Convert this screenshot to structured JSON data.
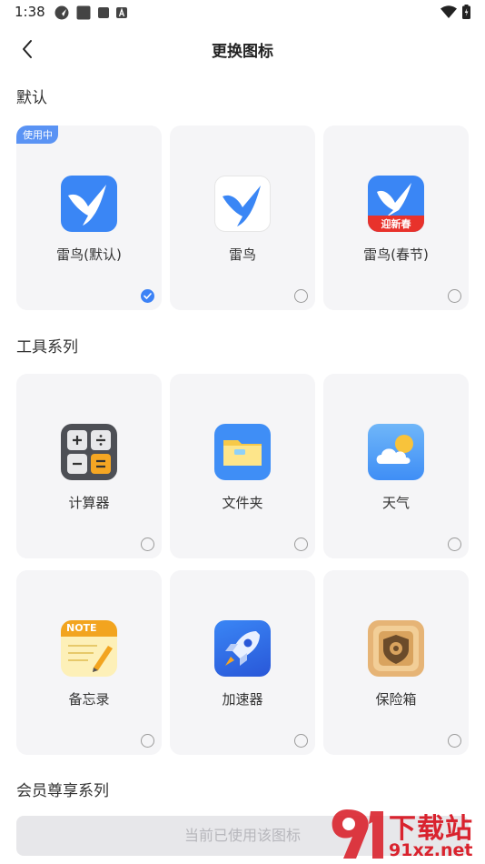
{
  "status": {
    "time": "1:38"
  },
  "header": {
    "title": "更换图标"
  },
  "sections": {
    "default": "默认",
    "tools": "工具系列",
    "vip": "会员尊享系列"
  },
  "default_icons": [
    {
      "label": "雷鸟(默认)",
      "badge": "使用中",
      "selected": true
    },
    {
      "label": "雷鸟",
      "selected": false
    },
    {
      "label": "雷鸟(春节)",
      "icon_text": "迎新春",
      "selected": false
    }
  ],
  "tool_icons": [
    {
      "label": "计算器",
      "icon": "calculator-icon"
    },
    {
      "label": "文件夹",
      "icon": "folder-icon"
    },
    {
      "label": "天气",
      "icon": "weather-icon"
    },
    {
      "label": "备忘录",
      "icon": "memo-icon",
      "icon_text": "NOTE"
    },
    {
      "label": "加速器",
      "icon": "rocket-icon"
    },
    {
      "label": "保险箱",
      "icon": "safe-icon"
    }
  ],
  "bottom_button": "当前已使用该图标",
  "watermark": {
    "brand": "下载站",
    "domain": "91xz.net"
  },
  "colors": {
    "accent": "#3c82f6",
    "card_bg": "#f5f5f7"
  }
}
